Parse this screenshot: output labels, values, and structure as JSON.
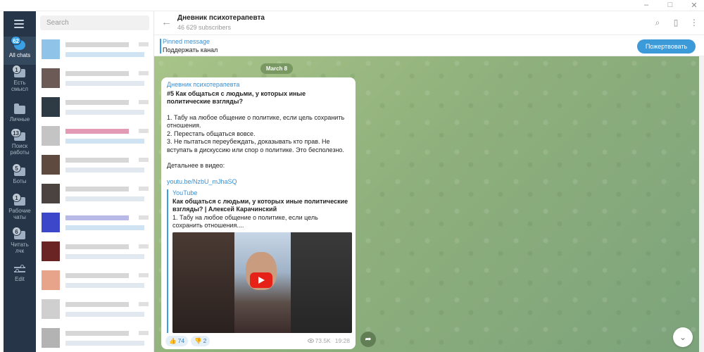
{
  "window": {
    "controls": [
      "–",
      "□",
      "✕"
    ]
  },
  "folders": {
    "all_chats": {
      "label": "All chats",
      "badge": "62",
      "icon": "chat-bubble-icon"
    },
    "items": [
      {
        "label1": "Есть",
        "label2": "смысл",
        "badge": "1",
        "icon": "folder-icon"
      },
      {
        "label1": "Личные",
        "label2": "",
        "badge": "",
        "icon": "folder-icon"
      },
      {
        "label1": "Поиск",
        "label2": "работы",
        "badge": "13",
        "icon": "folder-icon"
      },
      {
        "label1": "Боты",
        "label2": "",
        "badge": "5",
        "icon": "folder-icon"
      },
      {
        "label1": "Рабочие",
        "label2": "чаты",
        "badge": "1",
        "icon": "folder-icon"
      },
      {
        "label1": "Читать",
        "label2": "лчк",
        "badge": "6",
        "icon": "folder-icon"
      }
    ],
    "edit": {
      "label": "Edit",
      "icon": "sliders-icon"
    }
  },
  "chatlist": {
    "search_placeholder": "Search"
  },
  "header": {
    "title": "Дневник психотерапевта",
    "subscribers": "46 629 subscribers"
  },
  "pinned": {
    "title": "Pinned message",
    "text": "Поддержать канал",
    "button": "Пожертвовать"
  },
  "date_separator": "March 8",
  "message": {
    "author": "Дневник психотерапевта",
    "title": "#5 Как общаться с людьми, у которых иные политические взгляды?",
    "lines": [
      "1. Табу на любое общение о политике, если цель сохранить отношения.",
      "2. Перестать общаться вовсе.",
      "3. Не пытаться переубеждать, доказывать кто прав. Не вступать в дискуссию или спор о политике. Это бесполезно."
    ],
    "more_label": "Детальнее в видео:",
    "link": "youtu.be/NzbU_mJhaSQ",
    "preview": {
      "source": "YouTube",
      "title": "Как общаться с людьми, у которых иные политические взгляды? | Алексей Карачинский",
      "description": "1. Табу на любое общение о политике, если цель сохранить отношения...."
    },
    "reactions": [
      {
        "emoji": "👍",
        "count": "74"
      },
      {
        "emoji": "👎",
        "count": "2"
      }
    ],
    "views": "73.5K",
    "time": "19:28"
  }
}
